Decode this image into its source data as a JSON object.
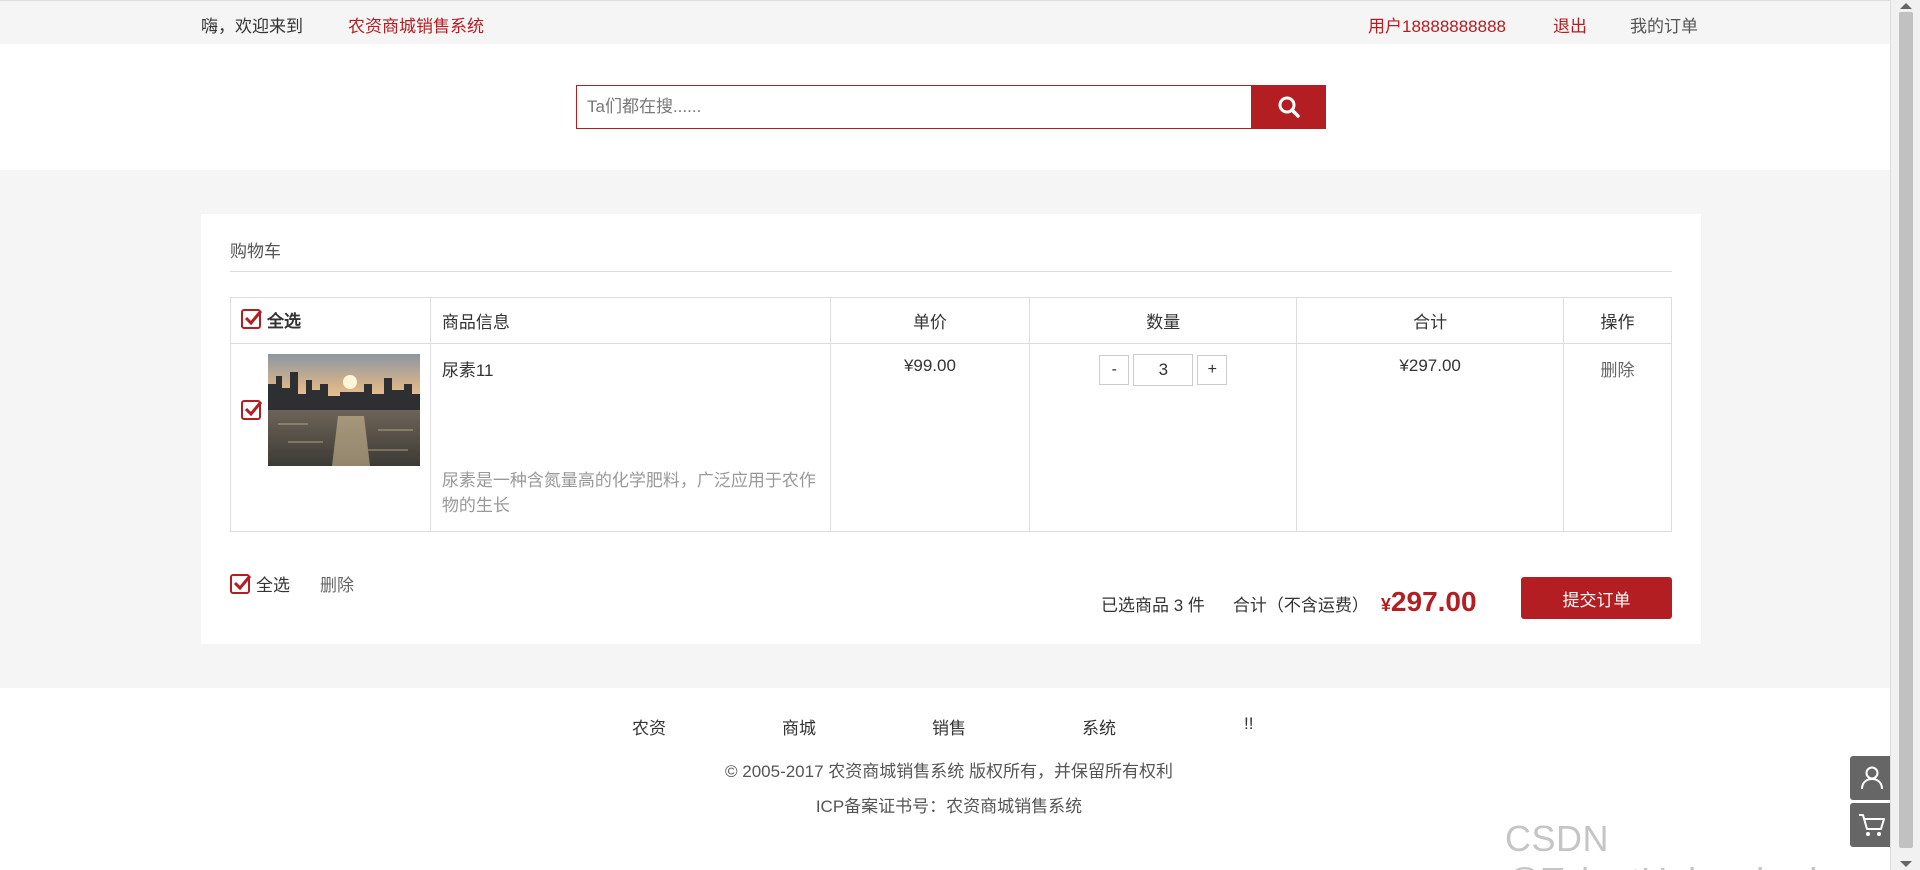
{
  "topbar": {
    "greeting": "嗨，欢迎来到",
    "site_name": "农资商城销售系统",
    "user": "用户18888888888",
    "logout": "退出",
    "my_orders": "我的订单"
  },
  "search": {
    "placeholder": "Ta们都在搜......",
    "icon": "search-icon"
  },
  "cart": {
    "title": "购物车",
    "columns": {
      "select_all": "全选",
      "product_info": "商品信息",
      "unit_price": "单价",
      "quantity": "数量",
      "subtotal": "合计",
      "action": "操作"
    },
    "items": [
      {
        "checked": true,
        "name": "尿素11",
        "description": "尿素是一种含氮量高的化学肥料，广泛应用于农作物的生长",
        "unit_price": "¥99.00",
        "quantity": "3",
        "subtotal": "¥297.00",
        "delete": "删除"
      }
    ],
    "qty_minus": "-",
    "qty_plus": "+",
    "footer": {
      "select_all": "全选",
      "delete": "删除",
      "selected_count": "已选商品 3 件",
      "total_label": "合计（不含运费）",
      "currency": "¥",
      "total_amount": "297.00",
      "submit": "提交订单"
    }
  },
  "footer": {
    "links": [
      "农资",
      "商城",
      "销售",
      "系统",
      "!!"
    ],
    "copyright": "© 2005-2017 农资商城销售系统 版权所有，并保留所有权利",
    "icp": "ICP备案证书号：农资商城销售系统"
  },
  "watermark": "CSDN @TalentUnleashed",
  "colors": {
    "accent": "#b31e22",
    "band": "#f5f5f5"
  }
}
